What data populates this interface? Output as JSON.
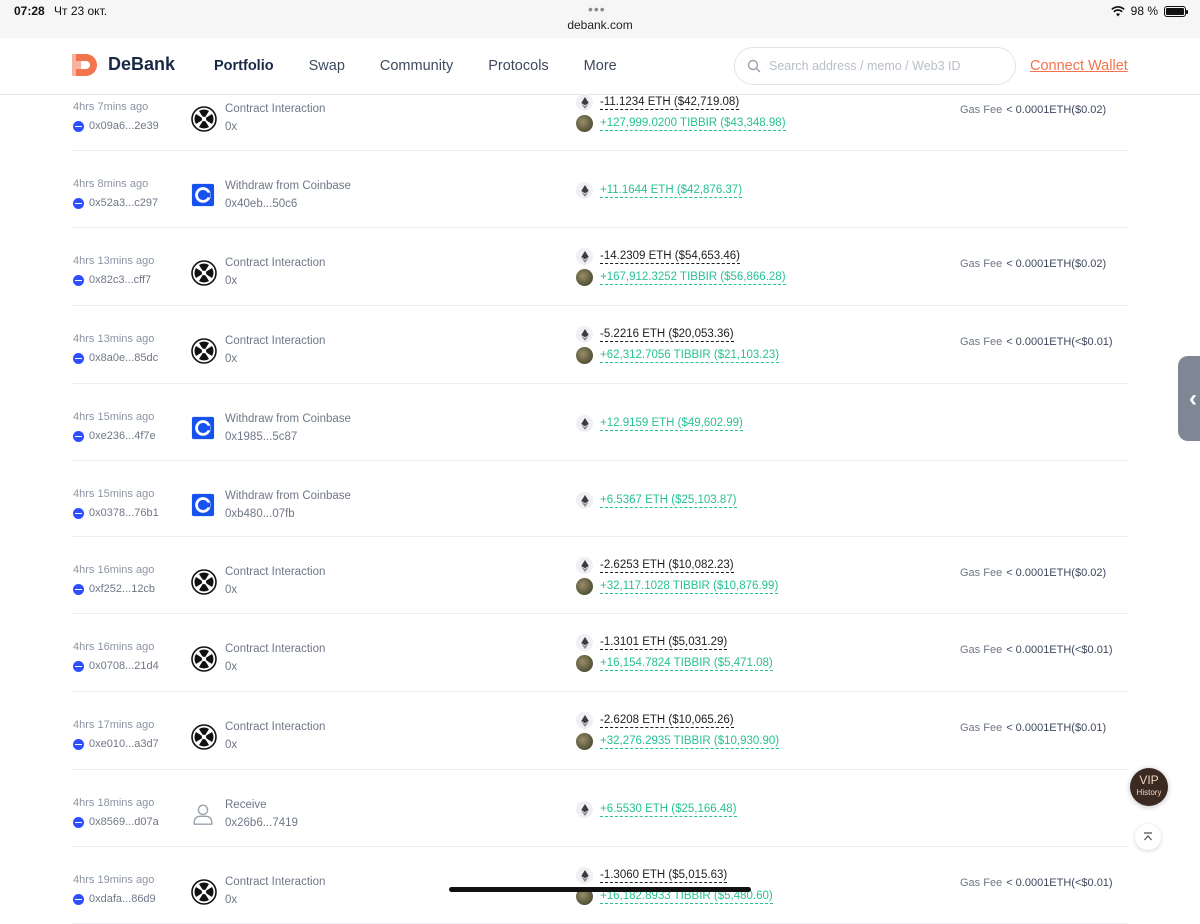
{
  "status_bar": {
    "time": "07:28",
    "date": "Чт 23 окт.",
    "url": "debank.com",
    "battery": "98 %",
    "battery_level": 0.98
  },
  "header": {
    "brand": "DeBank",
    "nav": [
      "Portfolio",
      "Swap",
      "Community",
      "Protocols",
      "More"
    ],
    "active_nav": "Portfolio",
    "search_placeholder": "Search address / memo / Web3 ID",
    "connect_label": "Connect Wallet",
    "brand_color": "#f2744f"
  },
  "icons": {
    "contract": "contract-interaction-icon",
    "coinbase": "coinbase-icon",
    "receive": "user-icon",
    "eth": "eth-icon",
    "tibbir": "tibbir-token-icon",
    "chain": "ethereum-chain-icon"
  },
  "transactions": [
    {
      "time": "4hrs 7mins ago",
      "addr": "0x09a6...2e39",
      "kind": "contract",
      "name": "Contract Interaction",
      "sub": "0x",
      "tokens": [
        {
          "icon": "eth",
          "sign": "neg",
          "text": "-11.1234 ETH ($42,719.08)"
        },
        {
          "icon": "tib",
          "sign": "pos",
          "text": "+127,999.0200 TIBBIR ($43,348.98)"
        }
      ],
      "gas_label": "Gas Fee",
      "gas": "< 0.0001ETH($0.02)"
    },
    {
      "time": "4hrs 8mins ago",
      "addr": "0x52a3...c297",
      "kind": "coinbase",
      "name": "Withdraw from Coinbase",
      "sub": "0x40eb...50c6",
      "tokens": [
        {
          "icon": "eth",
          "sign": "pos",
          "text": "+11.1644 ETH ($42,876.37)"
        }
      ]
    },
    {
      "time": "4hrs 13mins ago",
      "addr": "0x82c3...cff7",
      "kind": "contract",
      "name": "Contract Interaction",
      "sub": "0x",
      "tokens": [
        {
          "icon": "eth",
          "sign": "neg",
          "text": "-14.2309 ETH ($54,653.46)"
        },
        {
          "icon": "tib",
          "sign": "pos",
          "text": "+167,912.3252 TIBBIR ($56,866.28)"
        }
      ],
      "gas_label": "Gas Fee",
      "gas": "< 0.0001ETH($0.02)"
    },
    {
      "time": "4hrs 13mins ago",
      "addr": "0x8a0e...85dc",
      "kind": "contract",
      "name": "Contract Interaction",
      "sub": "0x",
      "tokens": [
        {
          "icon": "eth",
          "sign": "neg",
          "text": "-5.2216 ETH ($20,053.36)"
        },
        {
          "icon": "tib",
          "sign": "pos",
          "text": "+62,312.7056 TIBBIR ($21,103.23)"
        }
      ],
      "gas_label": "Gas Fee",
      "gas": "< 0.0001ETH(<$0.01)"
    },
    {
      "time": "4hrs 15mins ago",
      "addr": "0xe236...4f7e",
      "kind": "coinbase",
      "name": "Withdraw from Coinbase",
      "sub": "0x1985...5c87",
      "tokens": [
        {
          "icon": "eth",
          "sign": "pos",
          "text": "+12.9159 ETH ($49,602.99)"
        }
      ]
    },
    {
      "time": "4hrs 15mins ago",
      "addr": "0x0378...76b1",
      "kind": "coinbase",
      "name": "Withdraw from Coinbase",
      "sub": "0xb480...07fb",
      "tokens": [
        {
          "icon": "eth",
          "sign": "pos",
          "text": "+6.5367 ETH ($25,103.87)"
        }
      ]
    },
    {
      "time": "4hrs 16mins ago",
      "addr": "0xf252...12cb",
      "kind": "contract",
      "name": "Contract Interaction",
      "sub": "0x",
      "tokens": [
        {
          "icon": "eth",
          "sign": "neg",
          "text": "-2.6253 ETH ($10,082.23)"
        },
        {
          "icon": "tib",
          "sign": "pos",
          "text": "+32,117.1028 TIBBIR ($10,876.99)"
        }
      ],
      "gas_label": "Gas Fee",
      "gas": "< 0.0001ETH($0.02)"
    },
    {
      "time": "4hrs 16mins ago",
      "addr": "0x0708...21d4",
      "kind": "contract",
      "name": "Contract Interaction",
      "sub": "0x",
      "tokens": [
        {
          "icon": "eth",
          "sign": "neg",
          "text": "-1.3101 ETH ($5,031.29)"
        },
        {
          "icon": "tib",
          "sign": "pos",
          "text": "+16,154.7824 TIBBIR ($5,471.08)"
        }
      ],
      "gas_label": "Gas Fee",
      "gas": "< 0.0001ETH(<$0.01)"
    },
    {
      "time": "4hrs 17mins ago",
      "addr": "0xe010...a3d7",
      "kind": "contract",
      "name": "Contract Interaction",
      "sub": "0x",
      "tokens": [
        {
          "icon": "eth",
          "sign": "neg",
          "text": "-2.6208 ETH ($10,065.26)"
        },
        {
          "icon": "tib",
          "sign": "pos",
          "text": "+32,276.2935 TIBBIR ($10,930.90)"
        }
      ],
      "gas_label": "Gas Fee",
      "gas": "< 0.0001ETH($0.01)"
    },
    {
      "time": "4hrs 18mins ago",
      "addr": "0x8569...d07a",
      "kind": "receive",
      "name": "Receive",
      "sub": "0x26b6...7419",
      "tokens": [
        {
          "icon": "eth",
          "sign": "pos",
          "text": "+6.5530 ETH ($25,166.48)"
        }
      ]
    },
    {
      "time": "4hrs 19mins ago",
      "addr": "0xdafa...86d9",
      "kind": "contract",
      "name": "Contract Interaction",
      "sub": "0x",
      "tokens": [
        {
          "icon": "eth",
          "sign": "neg",
          "text": "-1.3060 ETH ($5,015.63)"
        },
        {
          "icon": "tib",
          "sign": "pos",
          "text": "+16,182.8933 TIBBIR ($5,480.60)"
        }
      ],
      "gas_label": "Gas Fee",
      "gas": "< 0.0001ETH(<$0.01)"
    }
  ],
  "floating": {
    "vip_label": "VIP",
    "vip_sub": "History"
  }
}
